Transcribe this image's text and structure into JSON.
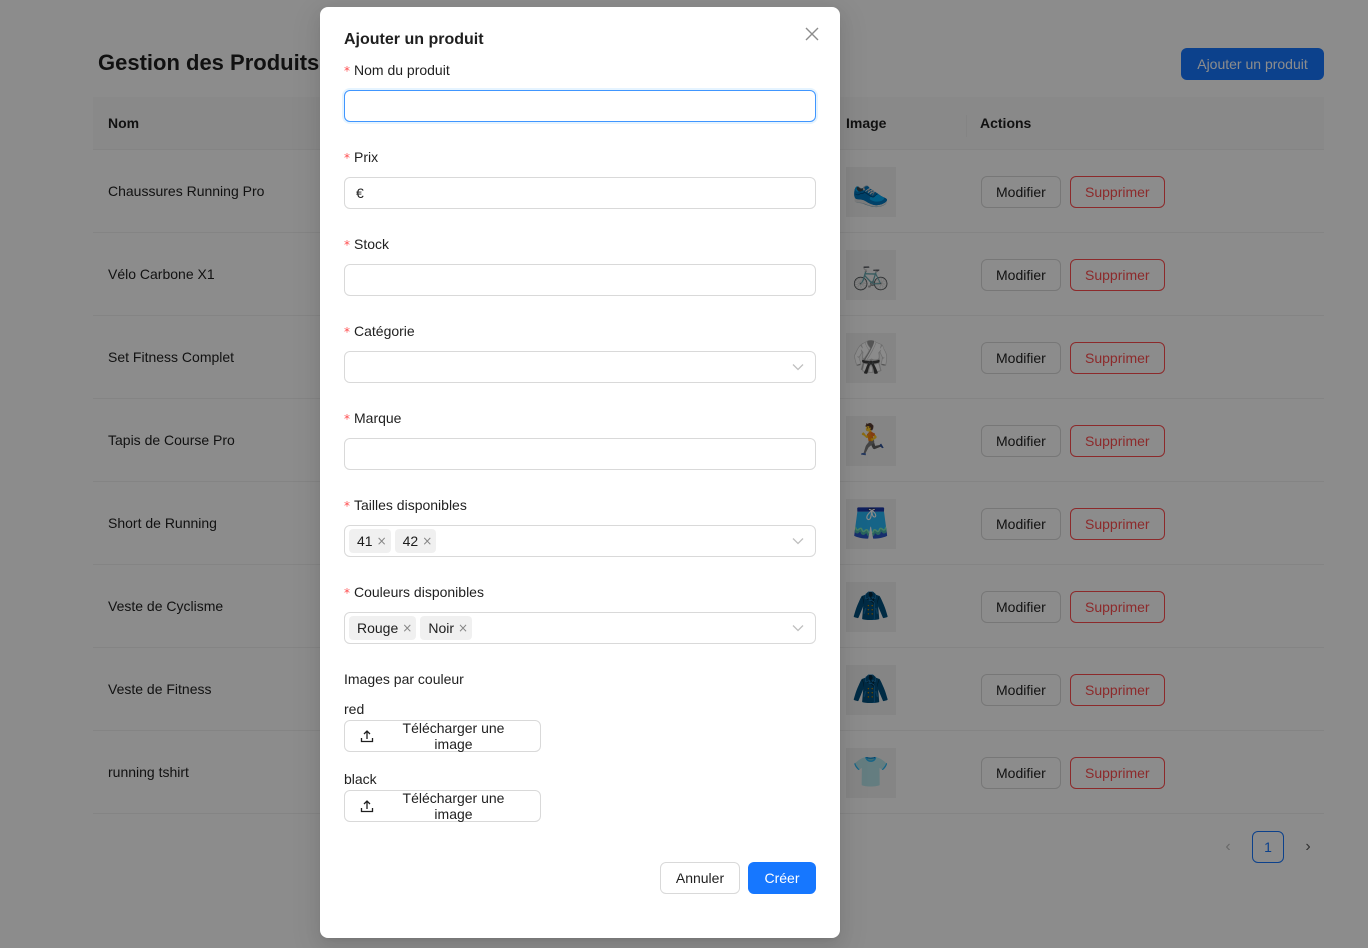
{
  "page": {
    "title": "Gestion des Produits",
    "add_button": "Ajouter un produit",
    "columns": [
      "Nom",
      "Image",
      "Actions"
    ],
    "rows": [
      {
        "name": "Chaussures Running Pro",
        "image_icon": "shoe-image-icon",
        "glyph": "👟"
      },
      {
        "name": "Vélo Carbone X1",
        "image_icon": "bike-image-icon",
        "glyph": "🚲"
      },
      {
        "name": "Set Fitness Complet",
        "image_icon": "fitness-set-image-icon",
        "glyph": "🥋"
      },
      {
        "name": "Tapis de Course Pro",
        "image_icon": "treadmill-image-icon",
        "glyph": "🏃"
      },
      {
        "name": "Short de Running",
        "image_icon": "shorts-image-icon",
        "glyph": "🩳"
      },
      {
        "name": "Veste de Cyclisme",
        "image_icon": "jacket-image-icon",
        "glyph": "🧥"
      },
      {
        "name": "Veste de Fitness",
        "image_icon": "jacket-image-icon",
        "glyph": "🧥"
      },
      {
        "name": "running tshirt",
        "image_icon": "tshirt-image-icon",
        "glyph": "👕"
      }
    ],
    "edit_label": "Modifier",
    "delete_label": "Supprimer",
    "pagination": {
      "current": "1",
      "prev": "‹",
      "next": "›"
    }
  },
  "modal": {
    "title": "Ajouter un produit",
    "close_glyph": "✕",
    "fields": {
      "name": {
        "label": "Nom du produit",
        "value": ""
      },
      "price": {
        "label": "Prix",
        "prefix": "€",
        "value": ""
      },
      "stock": {
        "label": "Stock",
        "value": ""
      },
      "category": {
        "label": "Catégorie",
        "value": ""
      },
      "brand": {
        "label": "Marque",
        "value": ""
      },
      "sizes": {
        "label": "Tailles disponibles",
        "tags": [
          "41",
          "42"
        ]
      },
      "colors": {
        "label": "Couleurs disponibles",
        "tags": [
          "Rouge",
          "Noir"
        ]
      }
    },
    "required_mark": "*",
    "tag_remove": "×",
    "images_by_color": {
      "title": "Images par couleur",
      "items": [
        {
          "color": "red",
          "upload_label": "Télécharger une image"
        },
        {
          "color": "black",
          "upload_label": "Télécharger une image"
        }
      ]
    },
    "cancel_label": "Annuler",
    "create_label": "Créer"
  },
  "colors": {
    "primary": "#1677ff",
    "danger": "#ff4d4f",
    "mask": "rgba(0,0,0,0.45)"
  }
}
